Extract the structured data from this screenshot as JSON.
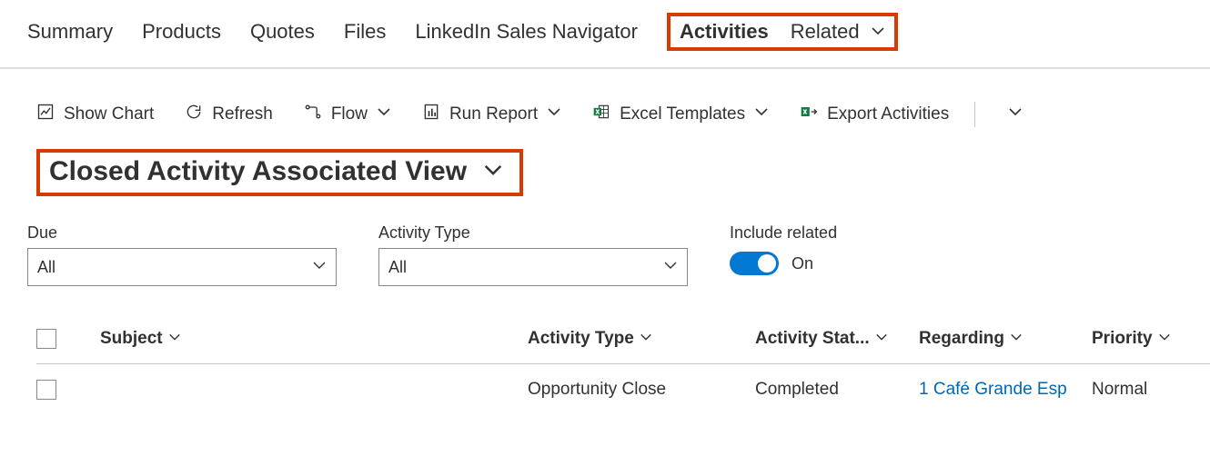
{
  "tabs": {
    "summary": "Summary",
    "products": "Products",
    "quotes": "Quotes",
    "files": "Files",
    "linkedin": "LinkedIn Sales Navigator",
    "activities": "Activities",
    "related": "Related"
  },
  "toolbar": {
    "show_chart": "Show Chart",
    "refresh": "Refresh",
    "flow": "Flow",
    "run_report": "Run Report",
    "excel_templates": "Excel Templates",
    "export_activities": "Export Activities"
  },
  "view": {
    "name": "Closed Activity Associated View"
  },
  "filters": {
    "due_label": "Due",
    "due_value": "All",
    "type_label": "Activity Type",
    "type_value": "All",
    "include_related_label": "Include related",
    "include_related_state": "On"
  },
  "columns": {
    "subject": "Subject",
    "activity_type": "Activity Type",
    "activity_status": "Activity Stat...",
    "regarding": "Regarding",
    "priority": "Priority"
  },
  "rows": [
    {
      "subject": "",
      "activity_type": "Opportunity Close",
      "activity_status": "Completed",
      "regarding": "1 Café Grande Esp",
      "priority": "Normal"
    }
  ]
}
